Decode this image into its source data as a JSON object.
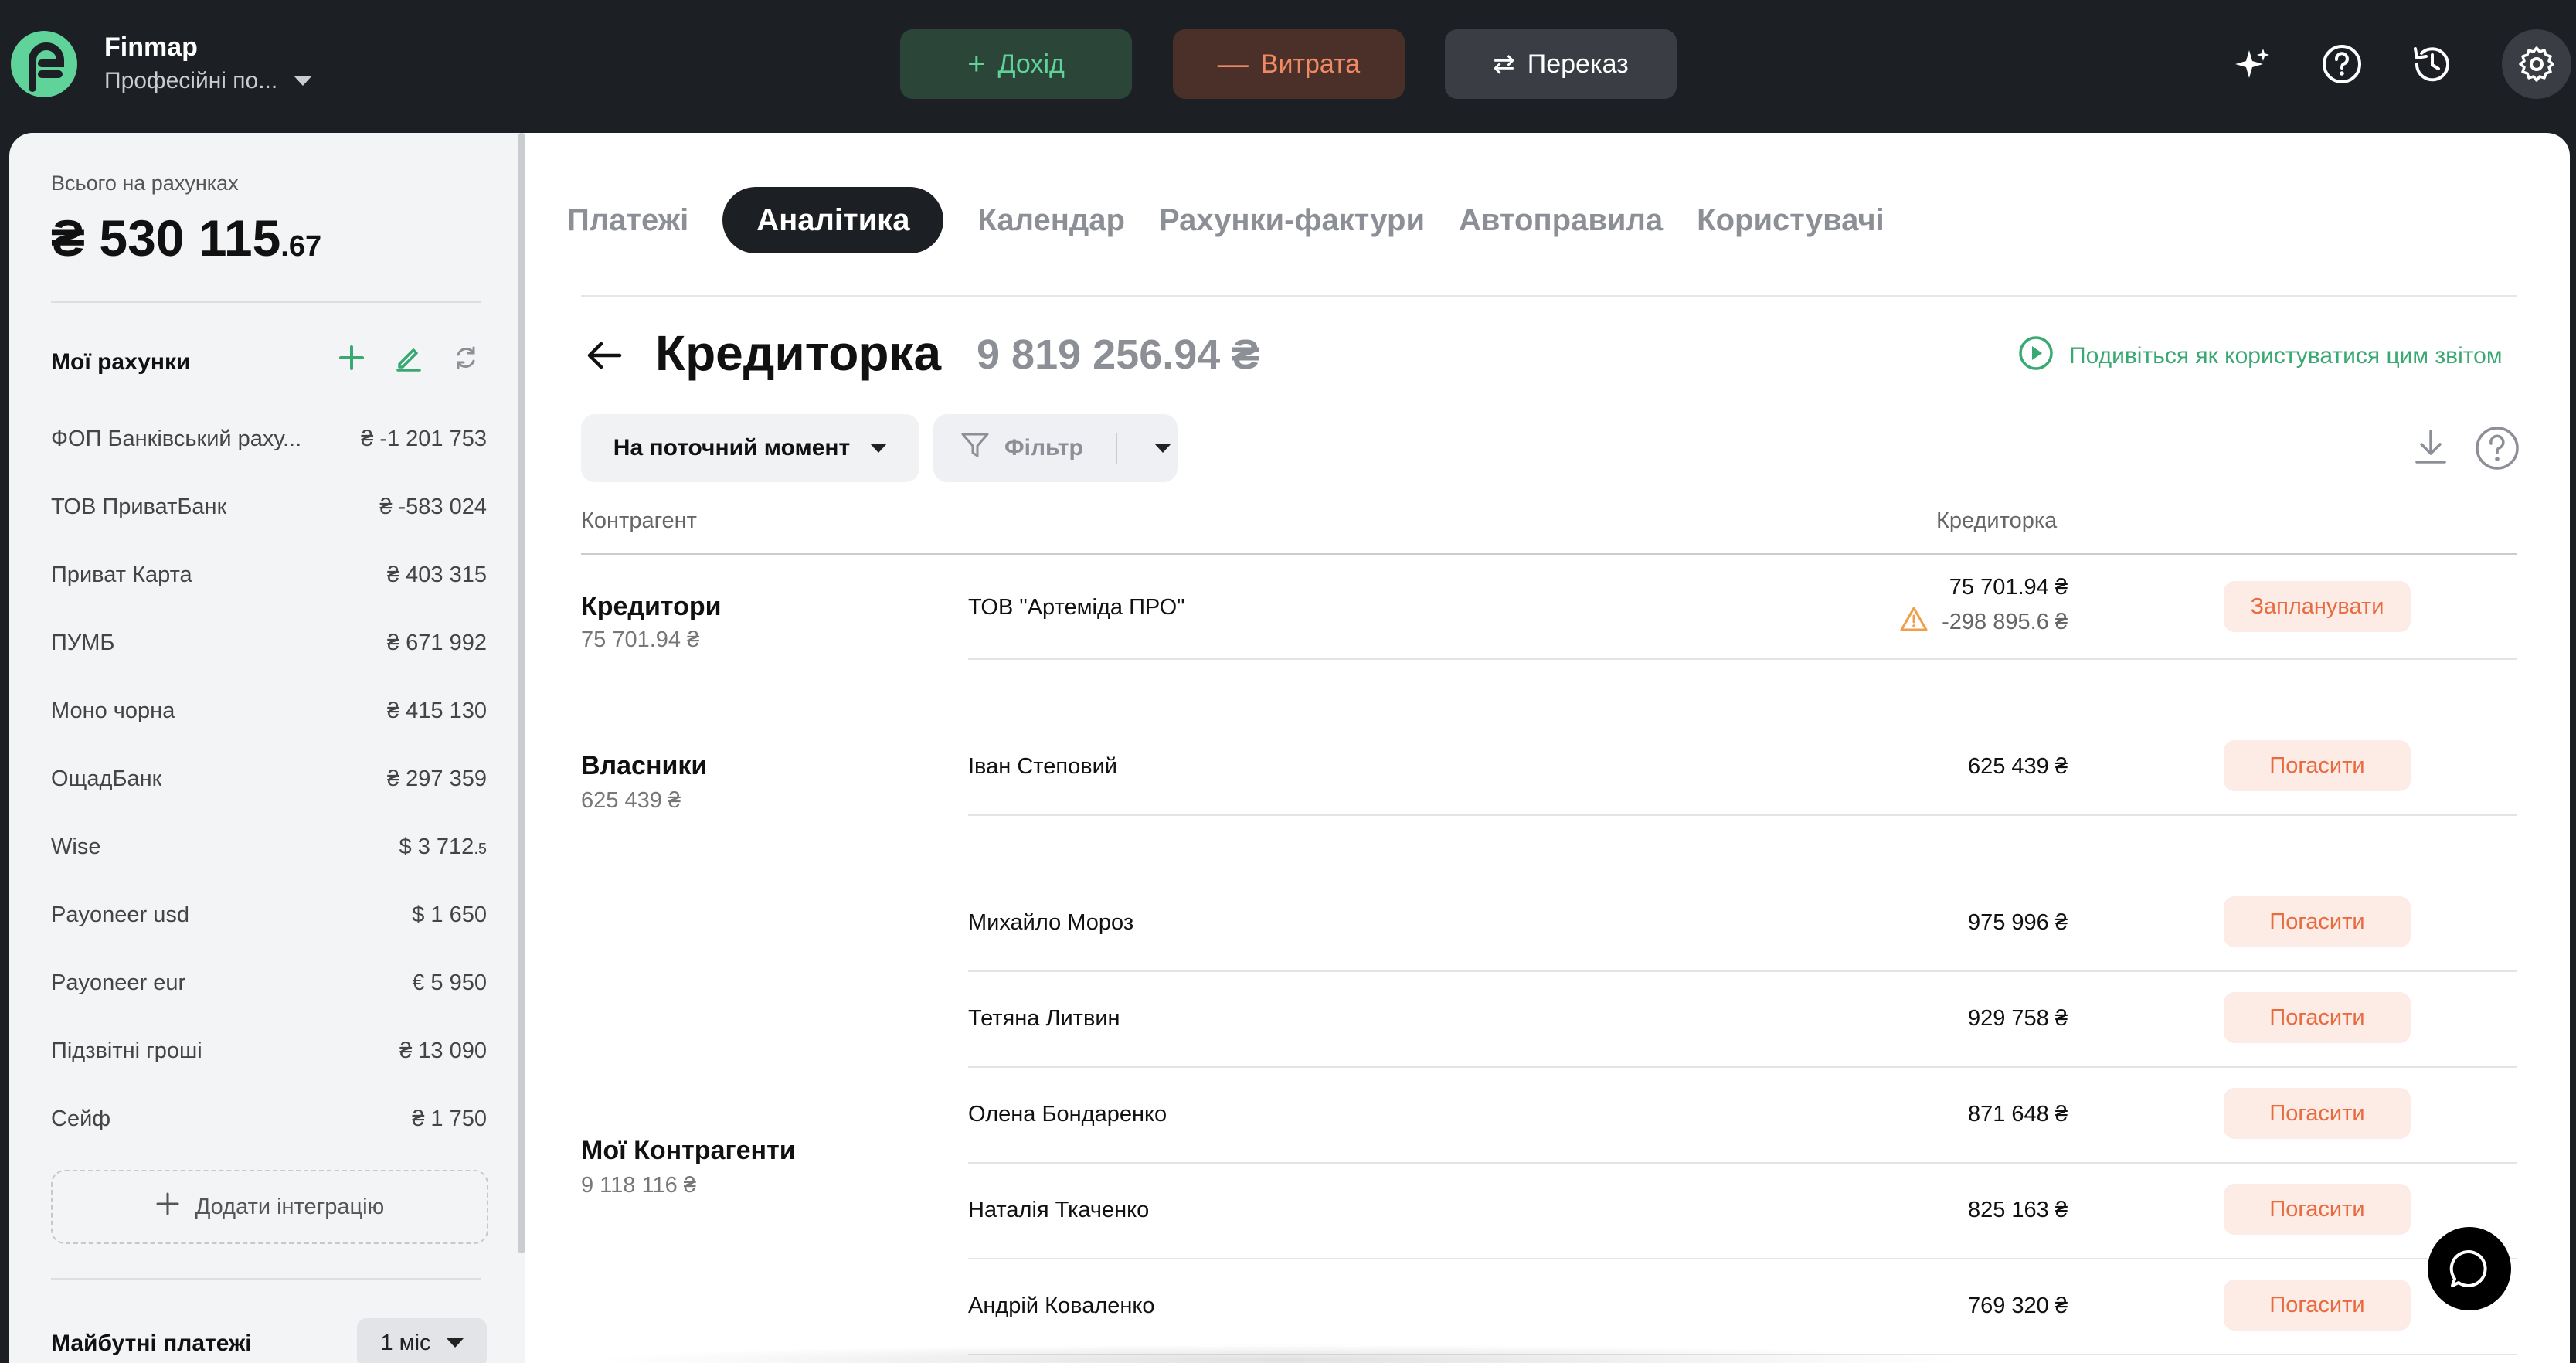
{
  "app": {
    "brand": "Finmap",
    "company": "Професійні по..."
  },
  "topbar": {
    "income_label": "Дохід",
    "expense_label": "Витрата",
    "transfer_label": "Переказ",
    "icons": [
      "sparkle-icon",
      "help-icon",
      "history-icon",
      "gear-icon"
    ]
  },
  "sidebar": {
    "total_label": "Всього на рахунках",
    "total_main": "₴ 530 115",
    "total_cents": ".67",
    "accounts_title": "Мої рахунки",
    "accounts": [
      {
        "name": "ФОП Банківський раху...",
        "balance": "₴ -1 201 753"
      },
      {
        "name": "ТОВ ПриватБанк",
        "balance": "₴ -583 024"
      },
      {
        "name": "Приват Карта",
        "balance": "₴ 403 315"
      },
      {
        "name": "ПУМБ",
        "balance": "₴ 671 992"
      },
      {
        "name": "Моно чорна",
        "balance": "₴ 415 130"
      },
      {
        "name": "ОщадБанк",
        "balance": "₴ 297 359"
      },
      {
        "name": "Wise",
        "balance": "$  3 712",
        "balance_small": ".5"
      },
      {
        "name": "Payoneer usd",
        "balance": "$  1 650"
      },
      {
        "name": "Payoneer eur",
        "balance": "€ 5 950"
      },
      {
        "name": "Підзвітні гроші",
        "balance": "₴ 13 090"
      },
      {
        "name": "Сейф",
        "balance": "₴ 1 750"
      }
    ],
    "add_integration": "Додати інтеграцію",
    "future_title": "Майбутні платежі",
    "future_period": "1 міс"
  },
  "tabs": [
    {
      "label": "Платежі",
      "active": false
    },
    {
      "label": "Аналітика",
      "active": true
    },
    {
      "label": "Календар",
      "active": false
    },
    {
      "label": "Рахунки-фактури",
      "active": false
    },
    {
      "label": "Автоправила",
      "active": false
    },
    {
      "label": "Користувачі",
      "active": false
    }
  ],
  "report": {
    "title": "Кредиторка",
    "total": "9 819 256.94 ₴",
    "howto": "Подивіться як користуватися цим звітом",
    "period": "На поточний момент",
    "filter": "Фільтр",
    "col_counterparty": "Контрагент",
    "col_credit": "Кредиторка"
  },
  "groups": [
    {
      "name": "Кредитори",
      "sum": "75 701.94 ₴",
      "rows": [
        {
          "name": "ТОВ \"Артеміда ПРО\"",
          "amount": "75 701.94 ₴",
          "sub": "-298 895.6 ₴",
          "action": "Запланувати"
        }
      ]
    },
    {
      "name": "Власники",
      "sum": "625 439 ₴",
      "rows": [
        {
          "name": "Іван Степовий",
          "amount": "625 439 ₴",
          "action": "Погасити"
        }
      ]
    },
    {
      "name": "Мої Контрагенти",
      "sum": "9 118 116 ₴",
      "rows": [
        {
          "name": "Михайло Мороз",
          "amount": "975 996 ₴",
          "action": "Погасити"
        },
        {
          "name": "Тетяна Литвин",
          "amount": "929 758 ₴",
          "action": "Погасити"
        },
        {
          "name": "Олена Бондаренко",
          "amount": "871 648 ₴",
          "action": "Погасити"
        },
        {
          "name": "Наталія Ткаченко",
          "amount": "825 163 ₴",
          "action": "Погасити"
        },
        {
          "name": "Андрій Коваленко",
          "amount": "769 320 ₴",
          "action": "Погасити"
        }
      ]
    }
  ],
  "colors": {
    "income": "#5fd39a",
    "expense": "#f08a65",
    "accent_green": "#3aa872",
    "action_orange": "#e86a3f"
  }
}
